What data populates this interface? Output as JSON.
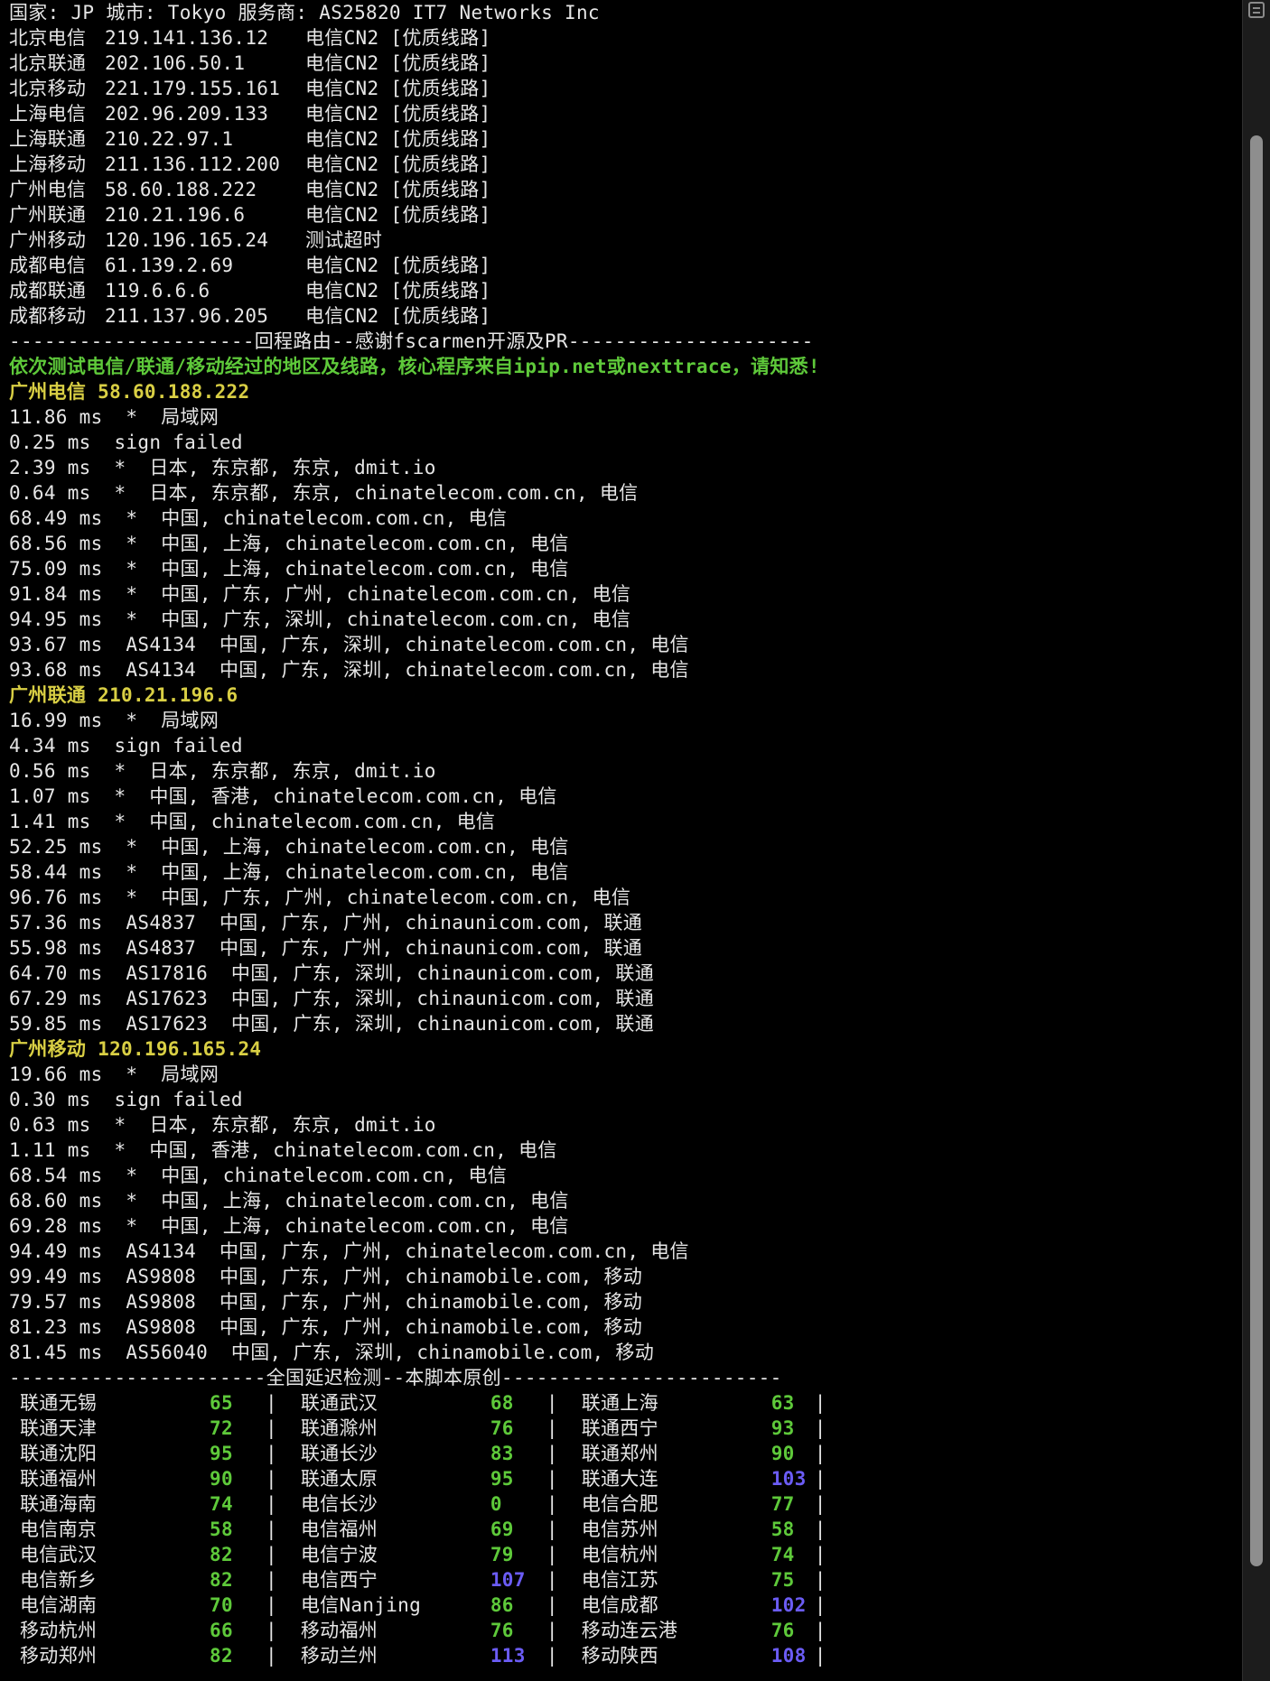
{
  "header": {
    "line": "国家: JP 城市: Tokyo 服务商: AS25820 IT7 Networks Inc"
  },
  "route_checks": [
    {
      "label": "北京电信",
      "ip": "219.141.136.12",
      "result": "电信CN2 [优质线路]"
    },
    {
      "label": "北京联通",
      "ip": "202.106.50.1",
      "result": "电信CN2 [优质线路]"
    },
    {
      "label": "北京移动",
      "ip": "221.179.155.161",
      "result": "电信CN2 [优质线路]"
    },
    {
      "label": "上海电信",
      "ip": "202.96.209.133",
      "result": "电信CN2 [优质线路]"
    },
    {
      "label": "上海联通",
      "ip": "210.22.97.1",
      "result": "电信CN2 [优质线路]"
    },
    {
      "label": "上海移动",
      "ip": "211.136.112.200",
      "result": "电信CN2 [优质线路]"
    },
    {
      "label": "广州电信",
      "ip": "58.60.188.222",
      "result": "电信CN2 [优质线路]"
    },
    {
      "label": "广州联通",
      "ip": "210.21.196.6",
      "result": "电信CN2 [优质线路]"
    },
    {
      "label": "广州移动",
      "ip": "120.196.165.24",
      "result": "测试超时"
    },
    {
      "label": "成都电信",
      "ip": "61.139.2.69",
      "result": "电信CN2 [优质线路]"
    },
    {
      "label": "成都联通",
      "ip": "119.6.6.6",
      "result": "电信CN2 [优质线路]"
    },
    {
      "label": "成都移动",
      "ip": "211.137.96.205",
      "result": "电信CN2 [优质线路]"
    }
  ],
  "separator_route": "---------------------回程路由--感谢fscarmen开源及PR---------------------",
  "route_note": "依次测试电信/联通/移动经过的地区及线路，核心程序来自ipip.net或nexttrace，请知悉!",
  "traces": [
    {
      "title": "广州电信 58.60.188.222",
      "hops": [
        "11.86 ms  *  局域网",
        "0.25 ms  sign failed",
        "2.39 ms  *  日本, 东京都, 东京, dmit.io",
        "0.64 ms  *  日本, 东京都, 东京, chinatelecom.com.cn, 电信",
        "68.49 ms  *  中国, chinatelecom.com.cn, 电信",
        "68.56 ms  *  中国, 上海, chinatelecom.com.cn, 电信",
        "75.09 ms  *  中国, 上海, chinatelecom.com.cn, 电信",
        "91.84 ms  *  中国, 广东, 广州, chinatelecom.com.cn, 电信",
        "94.95 ms  *  中国, 广东, 深圳, chinatelecom.com.cn, 电信",
        "93.67 ms  AS4134  中国, 广东, 深圳, chinatelecom.com.cn, 电信",
        "93.68 ms  AS4134  中国, 广东, 深圳, chinatelecom.com.cn, 电信"
      ]
    },
    {
      "title": "广州联通 210.21.196.6",
      "hops": [
        "16.99 ms  *  局域网",
        "4.34 ms  sign failed",
        "0.56 ms  *  日本, 东京都, 东京, dmit.io",
        "1.07 ms  *  中国, 香港, chinatelecom.com.cn, 电信",
        "1.41 ms  *  中国, chinatelecom.com.cn, 电信",
        "52.25 ms  *  中国, 上海, chinatelecom.com.cn, 电信",
        "58.44 ms  *  中国, 上海, chinatelecom.com.cn, 电信",
        "96.76 ms  *  中国, 广东, 广州, chinatelecom.com.cn, 电信",
        "57.36 ms  AS4837  中国, 广东, 广州, chinaunicom.com, 联通",
        "55.98 ms  AS4837  中国, 广东, 广州, chinaunicom.com, 联通",
        "64.70 ms  AS17816  中国, 广东, 深圳, chinaunicom.com, 联通",
        "67.29 ms  AS17623  中国, 广东, 深圳, chinaunicom.com, 联通",
        "59.85 ms  AS17623  中国, 广东, 深圳, chinaunicom.com, 联通"
      ]
    },
    {
      "title": "广州移动 120.196.165.24",
      "hops": [
        "19.66 ms  *  局域网",
        "0.30 ms  sign failed",
        "0.63 ms  *  日本, 东京都, 东京, dmit.io",
        "1.11 ms  *  中国, 香港, chinatelecom.com.cn, 电信",
        "68.54 ms  *  中国, chinatelecom.com.cn, 电信",
        "68.60 ms  *  中国, 上海, chinatelecom.com.cn, 电信",
        "69.28 ms  *  中国, 上海, chinatelecom.com.cn, 电信",
        "94.49 ms  AS4134  中国, 广东, 广州, chinatelecom.com.cn, 电信",
        "99.49 ms  AS9808  中国, 广东, 广州, chinamobile.com, 移动",
        "79.57 ms  AS9808  中国, 广东, 广州, chinamobile.com, 移动",
        "81.23 ms  AS9808  中国, 广东, 广州, chinamobile.com, 移动",
        "81.45 ms  AS56040  中国, 广东, 深圳, chinamobile.com, 移动"
      ]
    }
  ],
  "separator_latency": "----------------------全国延迟检测--本脚本原创------------------------",
  "latency_rows": [
    [
      {
        "name": "联通无锡",
        "ms": "65"
      },
      {
        "name": "联通武汉",
        "ms": "68"
      },
      {
        "name": "联通上海",
        "ms": "63"
      }
    ],
    [
      {
        "name": "联通天津",
        "ms": "72"
      },
      {
        "name": "联通滁州",
        "ms": "76"
      },
      {
        "name": "联通西宁",
        "ms": "93"
      }
    ],
    [
      {
        "name": "联通沈阳",
        "ms": "95"
      },
      {
        "name": "联通长沙",
        "ms": "83"
      },
      {
        "name": "联通郑州",
        "ms": "90"
      }
    ],
    [
      {
        "name": "联通福州",
        "ms": "90"
      },
      {
        "name": "联通太原",
        "ms": "95"
      },
      {
        "name": "联通大连",
        "ms": "103"
      }
    ],
    [
      {
        "name": "联通海南",
        "ms": "74"
      },
      {
        "name": "电信长沙",
        "ms": "0"
      },
      {
        "name": "电信合肥",
        "ms": "77"
      }
    ],
    [
      {
        "name": "电信南京",
        "ms": "58"
      },
      {
        "name": "电信福州",
        "ms": "69"
      },
      {
        "name": "电信苏州",
        "ms": "58"
      }
    ],
    [
      {
        "name": "电信武汉",
        "ms": "82"
      },
      {
        "name": "电信宁波",
        "ms": "79"
      },
      {
        "name": "电信杭州",
        "ms": "74"
      }
    ],
    [
      {
        "name": "电信新乡",
        "ms": "82"
      },
      {
        "name": "电信西宁",
        "ms": "107"
      },
      {
        "name": "电信江苏",
        "ms": "75"
      }
    ],
    [
      {
        "name": "电信湖南",
        "ms": "70"
      },
      {
        "name": "电信Nanjing",
        "ms": "86"
      },
      {
        "name": "电信成都",
        "ms": "102"
      }
    ],
    [
      {
        "name": "移动杭州",
        "ms": "66"
      },
      {
        "name": "移动福州",
        "ms": "76"
      },
      {
        "name": "移动连云港",
        "ms": "76"
      }
    ],
    [
      {
        "name": "移动郑州",
        "ms": "82"
      },
      {
        "name": "移动兰州",
        "ms": "113"
      },
      {
        "name": "移动陕西",
        "ms": "108"
      }
    ]
  ],
  "latency_colors": {
    "good": "#5ec93a",
    "slow": "#6b5cf5",
    "slow_threshold_ms": 100
  },
  "text_colors": {
    "default": "#e6e6e6",
    "note": "#5ec93a",
    "trace_title": "#d9cf44"
  },
  "scrollbar_icon": "list-icon"
}
